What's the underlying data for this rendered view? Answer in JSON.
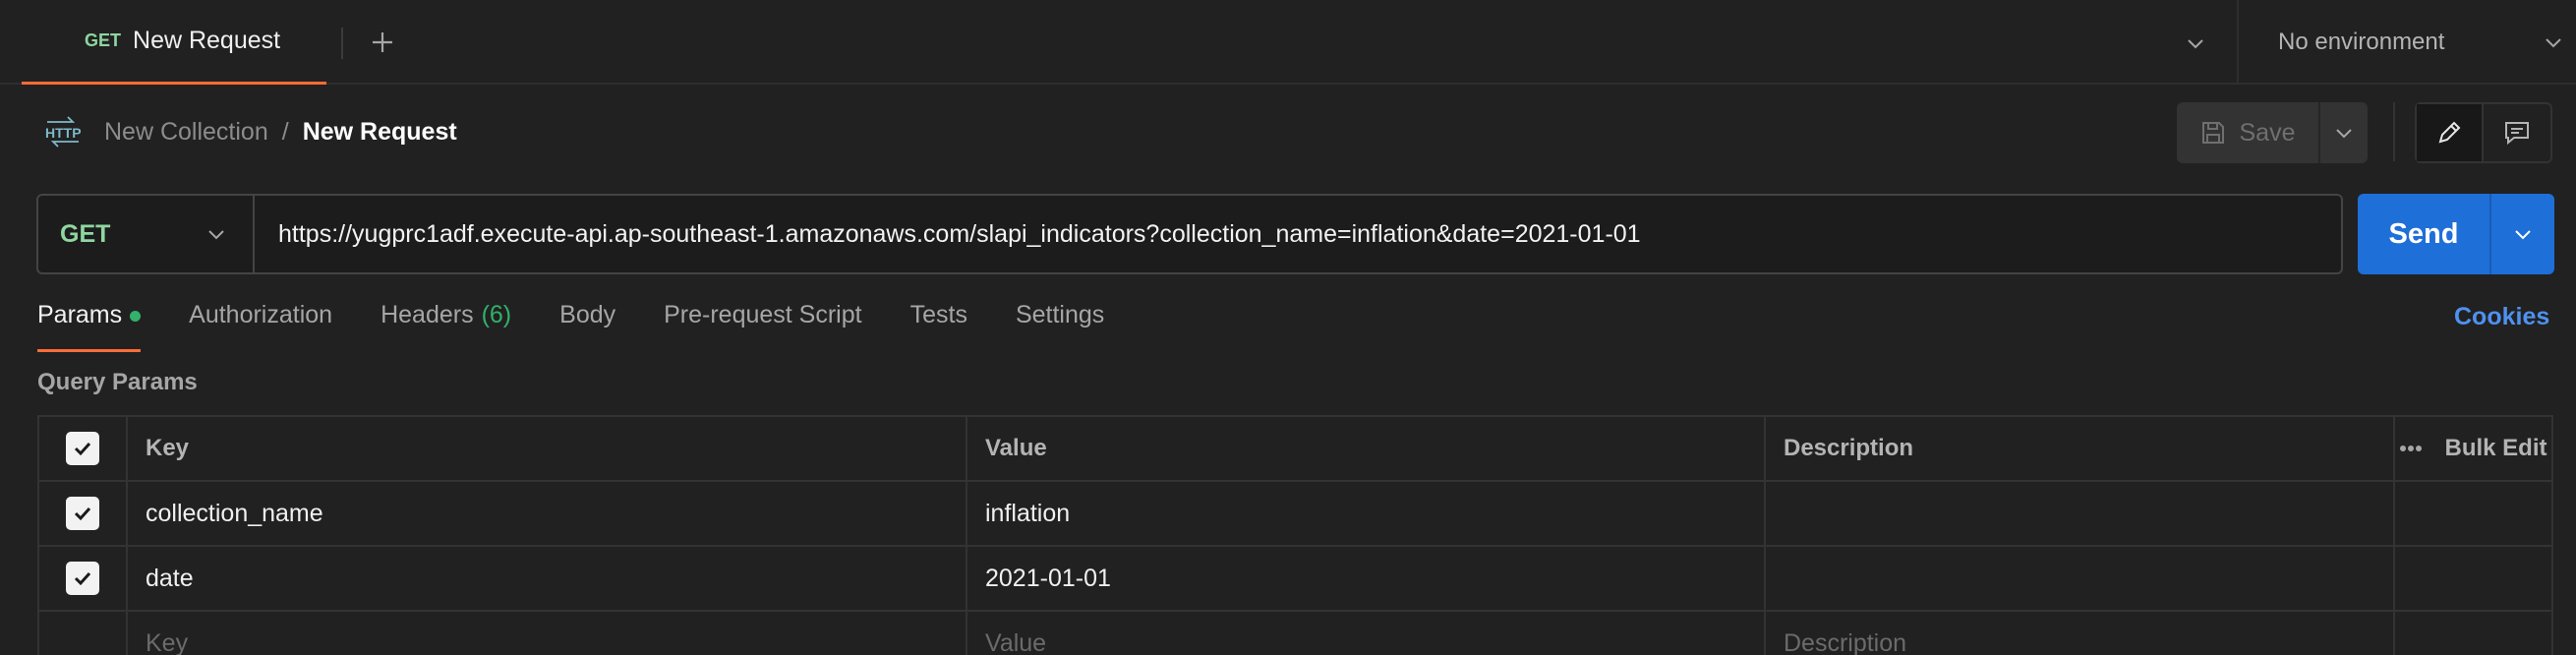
{
  "tab": {
    "method": "GET",
    "name": "New Request"
  },
  "environment": {
    "label": "No environment"
  },
  "breadcrumb": {
    "collection": "New Collection",
    "separator": "/",
    "request": "New Request"
  },
  "toolbar": {
    "save_label": "Save"
  },
  "request": {
    "method": "GET",
    "url": "https://yugprc1adf.execute-api.ap-southeast-1.amazonaws.com/slapi_indicators?collection_name=inflation&date=2021-01-01",
    "send_label": "Send"
  },
  "request_tabs": {
    "params": "Params",
    "authorization": "Authorization",
    "headers": "Headers",
    "headers_count": "(6)",
    "body": "Body",
    "prerequest": "Pre-request Script",
    "tests": "Tests",
    "settings": "Settings",
    "cookies": "Cookies"
  },
  "query_params": {
    "title": "Query Params",
    "headers": {
      "key": "Key",
      "value": "Value",
      "description": "Description",
      "bulk_edit": "Bulk Edit"
    },
    "rows": [
      {
        "key": "collection_name",
        "value": "inflation",
        "description": "",
        "checked": true
      },
      {
        "key": "date",
        "value": "2021-01-01",
        "description": "",
        "checked": true
      }
    ],
    "placeholders": {
      "key": "Key",
      "value": "Value",
      "description": "Description"
    }
  },
  "colors": {
    "accent": "#ff6c37",
    "method_get": "#8fd6a0",
    "send": "#1f6fd8",
    "cookies_link": "#4f91f0",
    "status_dot": "#31b16b"
  }
}
